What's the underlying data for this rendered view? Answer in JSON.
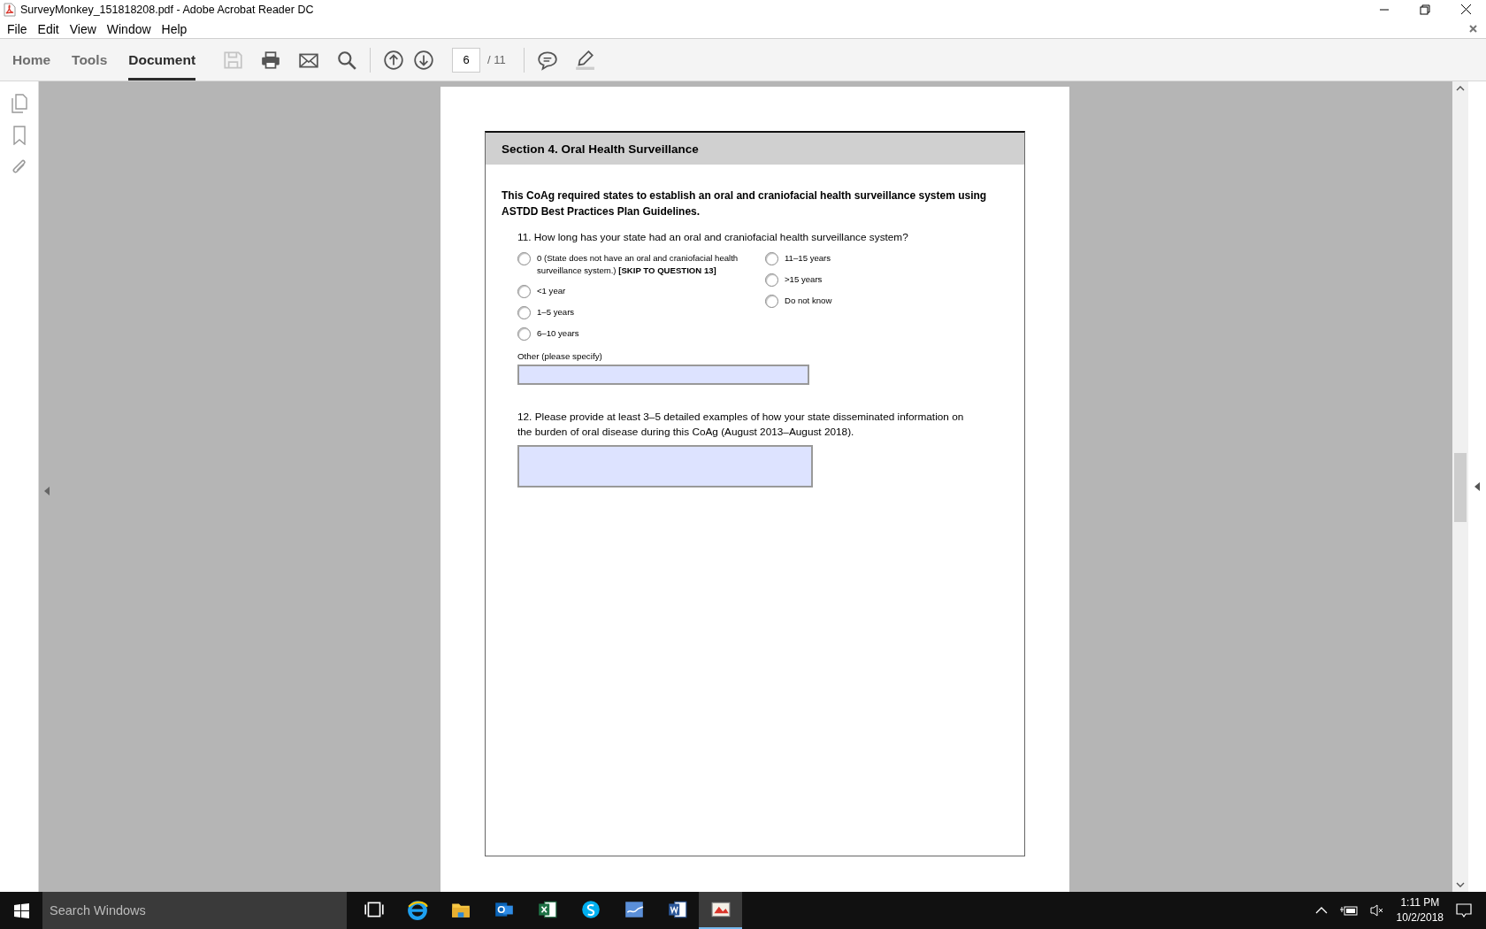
{
  "window": {
    "title": "SurveyMonkey_151818208.pdf - Adobe Acrobat Reader DC"
  },
  "menu": [
    "File",
    "Edit",
    "View",
    "Window",
    "Help"
  ],
  "toolbar": {
    "tabs": [
      {
        "label": "Home",
        "selected": false
      },
      {
        "label": "Tools",
        "selected": false
      },
      {
        "label": "Document",
        "selected": true
      }
    ],
    "tools": [
      {
        "kind": "save",
        "disabled": true
      },
      {
        "kind": "print",
        "disabled": false
      },
      {
        "kind": "mail",
        "disabled": false
      },
      {
        "kind": "search",
        "disabled": false
      }
    ],
    "nav": [
      {
        "kind": "up"
      },
      {
        "kind": "down"
      }
    ],
    "page": {
      "current": "6",
      "total": "/ 11"
    },
    "annotate": [
      {
        "kind": "comment"
      },
      {
        "kind": "highlight"
      }
    ]
  },
  "document": {
    "section_title": "Section 4. Oral Health Surveillance",
    "intro": "This CoAg required states to establish an oral and craniofacial health surveillance system using ASTDD Best Practices Plan Guidelines.",
    "question_11": {
      "text": "11. How long has your state had an oral and craniofacial health surveillance system?",
      "columns": [
        [
          {
            "label": "0 (State does not have an oral and craniofacial health surveillance system.) **[SKIP TO QUESTION 13]**",
            "selected": false
          },
          {
            "label": "<1 year",
            "selected": false
          },
          {
            "label": "1–5 years",
            "selected": false
          },
          {
            "label": "6–10 years",
            "selected": false
          }
        ],
        [
          {
            "label": "11–15 years",
            "selected": false
          },
          {
            "label": ">15 years",
            "selected": false
          },
          {
            "label": "Do not know",
            "selected": false
          }
        ]
      ],
      "other_label": "Other (please specify)"
    },
    "question_12": {
      "text": "12. Please provide at least 3–5 detailed examples of how your state disseminated information on the burden of oral disease during this CoAg (August 2013–August 2018)."
    }
  },
  "taskbar": {
    "search_placeholder": "Search Windows",
    "apps": [
      {
        "kind": "taskview",
        "active": false
      },
      {
        "kind": "browser",
        "active": false
      },
      {
        "kind": "folder",
        "active": false
      },
      {
        "kind": "mail",
        "active": false
      },
      {
        "kind": "sheet",
        "active": false
      },
      {
        "kind": "chat",
        "active": false
      },
      {
        "kind": "stats",
        "active": false
      },
      {
        "kind": "doc",
        "active": false
      },
      {
        "kind": "pdf",
        "active": true
      }
    ],
    "time": "1:11 PM",
    "date": "10/2/2018"
  }
}
